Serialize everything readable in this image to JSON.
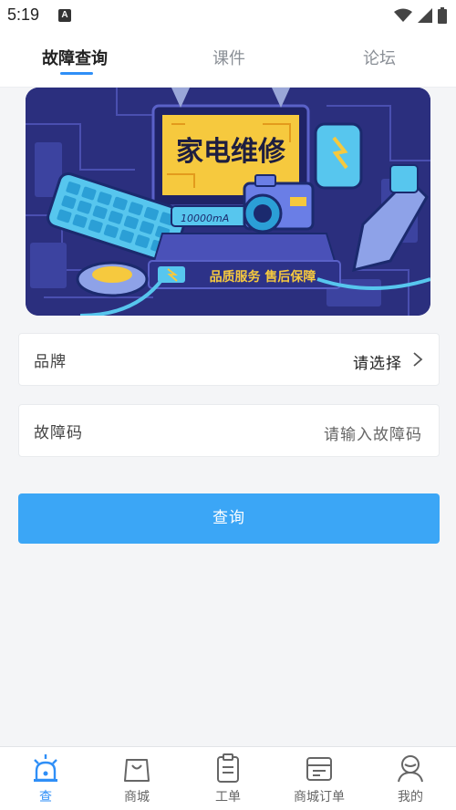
{
  "status_bar": {
    "time": "5:19",
    "notification_icon": "a-letter-icon",
    "icons": [
      "wifi-icon",
      "signal-icon",
      "battery-icon"
    ]
  },
  "tabs": [
    {
      "label": "故障查询",
      "active": true
    },
    {
      "label": "课件",
      "active": false
    },
    {
      "label": "论坛",
      "active": false
    }
  ],
  "banner": {
    "title": "家电维修",
    "subtitle": "品质服务 售后保障",
    "battery_text": "10000mA"
  },
  "form": {
    "brand": {
      "label": "品牌",
      "value": "请选择"
    },
    "fault_code": {
      "label": "故障码",
      "placeholder": "请输入故障码"
    },
    "query_button": "查询"
  },
  "bottom_nav": [
    {
      "label": "查",
      "icon": "alarm-beacon-icon",
      "active": true
    },
    {
      "label": "商城",
      "icon": "shopping-bag-icon",
      "active": false
    },
    {
      "label": "工单",
      "icon": "clipboard-icon",
      "active": false
    },
    {
      "label": "商城订单",
      "icon": "order-box-icon",
      "active": false
    },
    {
      "label": "我的",
      "icon": "user-icon",
      "active": false
    }
  ],
  "colors": {
    "accent": "#2f8ff7",
    "button": "#3ba6f6",
    "banner_bg": "#2b2f7e"
  }
}
